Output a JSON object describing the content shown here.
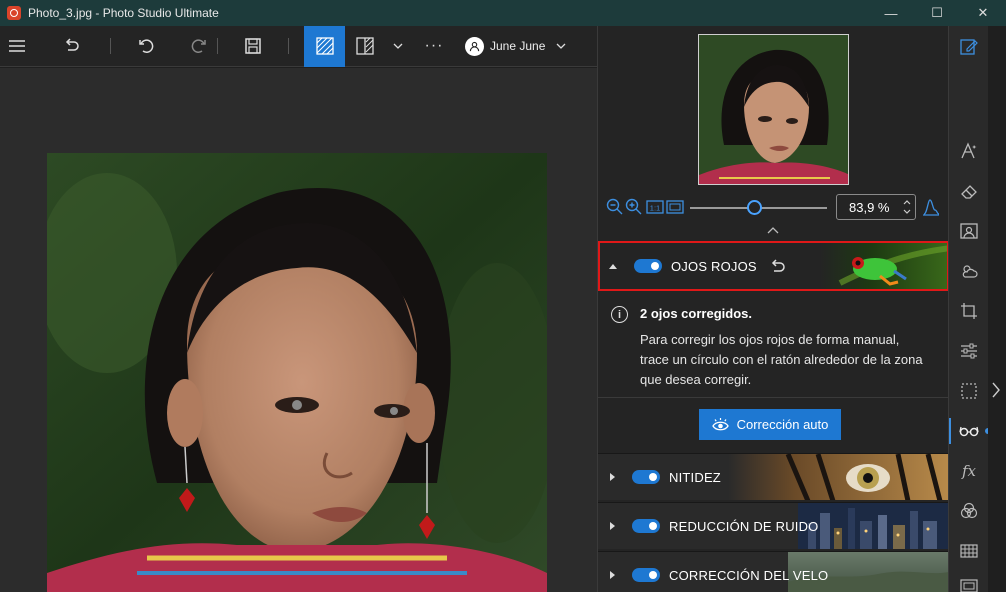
{
  "window": {
    "title": "Photo_3.jpg - Photo Studio Ultimate",
    "minimize": "—",
    "maximize": "☐",
    "close": "✕"
  },
  "toolbar": {
    "more": "···",
    "user_name": "June June"
  },
  "zoom": {
    "value": "83,9 %",
    "slider_level": 0.47
  },
  "sections": {
    "red_eye": {
      "label": "OJOS ROJOS",
      "enabled": true,
      "info_title": "2 ojos corregidos.",
      "info_body": "Para corregir los ojos rojos de forma manual, trace un círculo con el ratón alrededor de la zona que desea corregir.",
      "auto_button": "Corrección auto"
    },
    "list": [
      {
        "label": "NITIDEZ",
        "enabled": true
      },
      {
        "label": "REDUCCIÓN DE RUIDO",
        "enabled": true
      },
      {
        "label": "CORRECCIÓN DEL VELO",
        "enabled": true
      }
    ]
  },
  "colors": {
    "accent": "#1e78d2",
    "highlight_border": "#e01818",
    "titlebar": "#1d3b3b"
  }
}
